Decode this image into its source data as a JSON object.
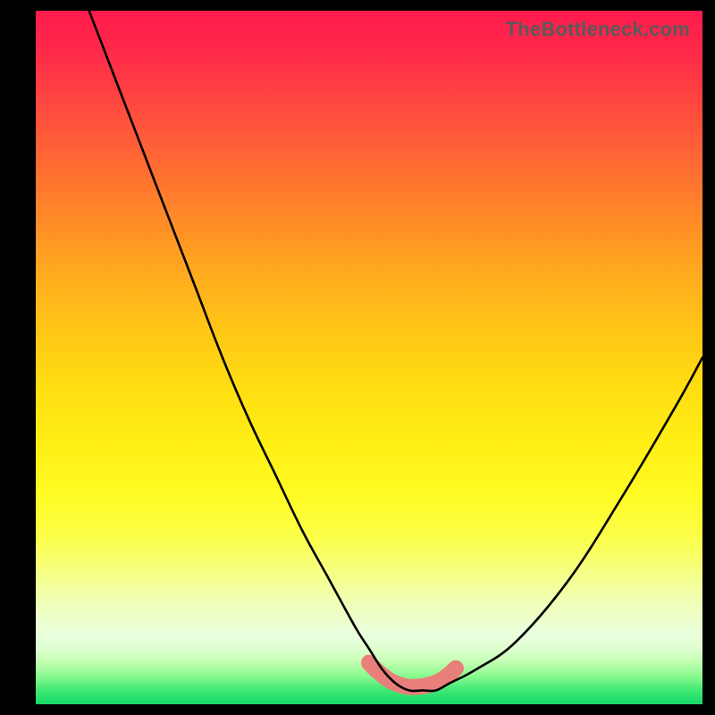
{
  "watermark": "TheBottleneck.com",
  "chart_data": {
    "type": "line",
    "title": "",
    "xlabel": "",
    "ylabel": "",
    "xlim": [
      0,
      100
    ],
    "ylim": [
      0,
      100
    ],
    "grid": false,
    "series": [
      {
        "name": "black-curve",
        "color": "#000000",
        "x": [
          8,
          12,
          16,
          20,
          24,
          28,
          32,
          36,
          40,
          44,
          48,
          50,
          52,
          54,
          56,
          58,
          60,
          62,
          66,
          72,
          80,
          88,
          96,
          100
        ],
        "values": [
          100,
          90,
          80,
          70,
          60,
          50,
          41,
          33,
          25,
          18,
          11,
          8,
          5,
          3,
          2,
          2,
          2,
          3,
          5,
          9,
          18,
          30,
          43,
          50
        ]
      },
      {
        "name": "salmon-band",
        "color": "#e97f7a",
        "x": [
          50,
          51,
          52,
          53,
          54,
          55,
          56,
          57,
          58,
          59,
          60,
          61,
          62,
          63
        ],
        "values": [
          6,
          5,
          4.2,
          3.5,
          3,
          2.7,
          2.5,
          2.5,
          2.6,
          2.8,
          3.1,
          3.6,
          4.3,
          5.2
        ]
      }
    ]
  }
}
